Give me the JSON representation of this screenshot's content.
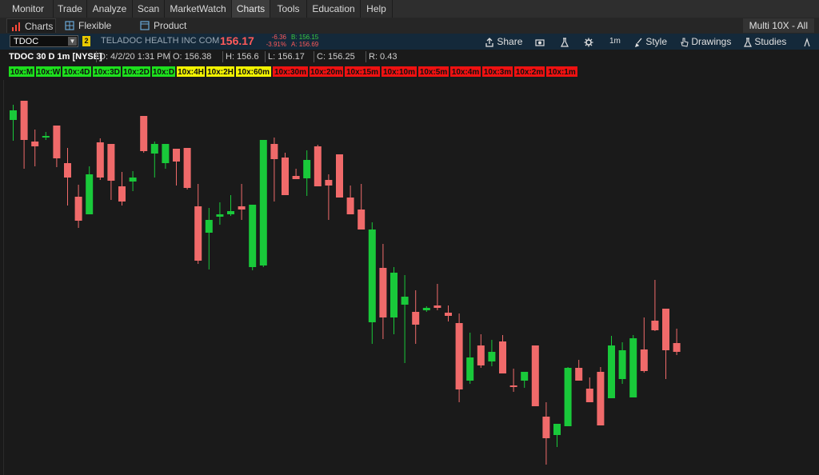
{
  "menu": {
    "items": [
      "Monitor",
      "Trade",
      "Analyze",
      "Scan",
      "MarketWatch",
      "Charts",
      "Tools",
      "Education",
      "Help"
    ],
    "active": "Charts"
  },
  "subtabs": {
    "items": [
      "Charts",
      "Flexible Grid",
      "Product Depth"
    ],
    "active": "Charts",
    "layout_label": "Multi 10X - All"
  },
  "toolbar": {
    "symbol": "TDOC",
    "link_badge": "2",
    "company_name": "TELADOC HEALTH INC COM",
    "last_price": "156.17",
    "net_change": "-6.36",
    "pct_change": "-3.91%",
    "bid": "B: 156.15",
    "ask": "A: 156.69",
    "share_label": "Share",
    "timeframe_label": "1m",
    "style_label": "Style",
    "drawings_label": "Drawings",
    "studies_label": "Studies",
    "patterns_label": "P"
  },
  "info_line": {
    "title": "TDOC 30 D 1m [NYSE]",
    "date": "D: 4/2/20 1:31 PM",
    "open": "O: 156.38",
    "high": "H: 156.6",
    "low": "L: 156.17",
    "close": "C: 156.25",
    "range": "R: 0.43"
  },
  "signals": [
    {
      "label": "10x:M",
      "status": "green"
    },
    {
      "label": "10x:W",
      "status": "green"
    },
    {
      "label": "10x:4D",
      "status": "green"
    },
    {
      "label": "10x:3D",
      "status": "green"
    },
    {
      "label": "10x:2D",
      "status": "green"
    },
    {
      "label": "10x:D",
      "status": "green"
    },
    {
      "label": "10x:4H",
      "status": "yellow"
    },
    {
      "label": "10x:2H",
      "status": "yellow"
    },
    {
      "label": "10x:60m",
      "status": "yellow"
    },
    {
      "label": "10x:30m",
      "status": "red"
    },
    {
      "label": "10x:20m",
      "status": "red"
    },
    {
      "label": "10x:15m",
      "status": "red"
    },
    {
      "label": "10x:10m",
      "status": "red"
    },
    {
      "label": "10x:5m",
      "status": "red"
    },
    {
      "label": "10x:4m",
      "status": "red"
    },
    {
      "label": "10x:3m",
      "status": "red"
    },
    {
      "label": "10x:2m",
      "status": "red"
    },
    {
      "label": "10x:1m",
      "status": "red"
    }
  ],
  "colors": {
    "up": "#19c93a",
    "down": "#f06a6a",
    "background": "#1a1a1a",
    "toolbar": "#14293a"
  },
  "chart_data": {
    "type": "candlestick",
    "candles": [
      {
        "o": 150,
        "h": 131,
        "l": 176,
        "c": 138
      },
      {
        "o": 126,
        "h": 126,
        "l": 211,
        "c": 175
      },
      {
        "o": 177,
        "h": 162,
        "l": 208,
        "c": 183
      },
      {
        "o": 171,
        "h": 165,
        "l": 175,
        "c": 170
      },
      {
        "o": 157,
        "h": 157,
        "l": 209,
        "c": 198
      },
      {
        "o": 204,
        "h": 185,
        "l": 257,
        "c": 222
      },
      {
        "o": 246,
        "h": 231,
        "l": 285,
        "c": 276
      },
      {
        "o": 268,
        "h": 208,
        "l": 268,
        "c": 218
      },
      {
        "o": 178,
        "h": 173,
        "l": 225,
        "c": 222
      },
      {
        "o": 180,
        "h": 180,
        "l": 250,
        "c": 226
      },
      {
        "o": 233,
        "h": 215,
        "l": 257,
        "c": 252
      },
      {
        "o": 227,
        "h": 214,
        "l": 239,
        "c": 222
      },
      {
        "o": 145,
        "h": 145,
        "l": 191,
        "c": 189
      },
      {
        "o": 192,
        "h": 177,
        "l": 222,
        "c": 180
      },
      {
        "o": 204,
        "h": 185,
        "l": 211,
        "c": 180
      },
      {
        "o": 186,
        "h": 186,
        "l": 232,
        "c": 202
      },
      {
        "o": 185,
        "h": 185,
        "l": 237,
        "c": 235
      },
      {
        "o": 258,
        "h": 230,
        "l": 330,
        "c": 326
      },
      {
        "o": 291,
        "h": 260,
        "l": 337,
        "c": 275
      },
      {
        "o": 271,
        "h": 253,
        "l": 281,
        "c": 268
      },
      {
        "o": 268,
        "h": 244,
        "l": 270,
        "c": 264
      },
      {
        "o": 258,
        "h": 230,
        "l": 275,
        "c": 262
      },
      {
        "o": 334,
        "h": 260,
        "l": 338,
        "c": 256
      },
      {
        "o": 332,
        "h": 332,
        "l": 334,
        "c": 175
      },
      {
        "o": 180,
        "h": 172,
        "l": 252,
        "c": 199
      },
      {
        "o": 197,
        "h": 191,
        "l": 242,
        "c": 244
      },
      {
        "o": 220,
        "h": 211,
        "l": 224,
        "c": 224
      },
      {
        "o": 223,
        "h": 188,
        "l": 245,
        "c": 200
      },
      {
        "o": 183,
        "h": 181,
        "l": 233,
        "c": 233
      },
      {
        "o": 225,
        "h": 218,
        "l": 275,
        "c": 232
      },
      {
        "o": 193,
        "h": 193,
        "l": 247,
        "c": 247
      },
      {
        "o": 247,
        "h": 232,
        "l": 268,
        "c": 268
      },
      {
        "o": 262,
        "h": 230,
        "l": 285,
        "c": 287
      },
      {
        "o": 403,
        "h": 278,
        "l": 430,
        "c": 287
      },
      {
        "o": 335,
        "h": 305,
        "l": 424,
        "c": 397
      },
      {
        "o": 397,
        "h": 334,
        "l": 418,
        "c": 341
      },
      {
        "o": 381,
        "h": 344,
        "l": 454,
        "c": 371
      },
      {
        "o": 390,
        "h": 363,
        "l": 430,
        "c": 406
      },
      {
        "o": 388,
        "h": 383,
        "l": 390,
        "c": 385
      },
      {
        "o": 382,
        "h": 355,
        "l": 388,
        "c": 385
      },
      {
        "o": 391,
        "h": 382,
        "l": 402,
        "c": 395
      },
      {
        "o": 404,
        "h": 392,
        "l": 503,
        "c": 487
      },
      {
        "o": 476,
        "h": 416,
        "l": 480,
        "c": 447
      },
      {
        "o": 432,
        "h": 418,
        "l": 460,
        "c": 457
      },
      {
        "o": 452,
        "h": 425,
        "l": 458,
        "c": 440
      },
      {
        "o": 427,
        "h": 419,
        "l": 467,
        "c": 467
      },
      {
        "o": 482,
        "h": 461,
        "l": 490,
        "c": 482
      },
      {
        "o": 476,
        "h": 467,
        "l": 485,
        "c": 465
      },
      {
        "o": 432,
        "h": 432,
        "l": 508,
        "c": 508
      },
      {
        "o": 521,
        "h": 503,
        "l": 581,
        "c": 548
      },
      {
        "o": 544,
        "h": 532,
        "l": 559,
        "c": 530
      },
      {
        "o": 533,
        "h": 459,
        "l": 533,
        "c": 460
      },
      {
        "o": 460,
        "h": 450,
        "l": 476,
        "c": 476
      },
      {
        "o": 486,
        "h": 472,
        "l": 503,
        "c": 503
      },
      {
        "o": 465,
        "h": 459,
        "l": 532,
        "c": 532
      },
      {
        "o": 498,
        "h": 420,
        "l": 498,
        "c": 432
      },
      {
        "o": 474,
        "h": 428,
        "l": 480,
        "c": 438
      },
      {
        "o": 497,
        "h": 419,
        "l": 497,
        "c": 423
      },
      {
        "o": 437,
        "h": 397,
        "l": 466,
        "c": 464
      },
      {
        "o": 401,
        "h": 350,
        "l": 414,
        "c": 413
      },
      {
        "o": 386,
        "h": 386,
        "l": 474,
        "c": 438
      },
      {
        "o": 429,
        "h": 411,
        "l": 444,
        "c": 440
      }
    ]
  }
}
